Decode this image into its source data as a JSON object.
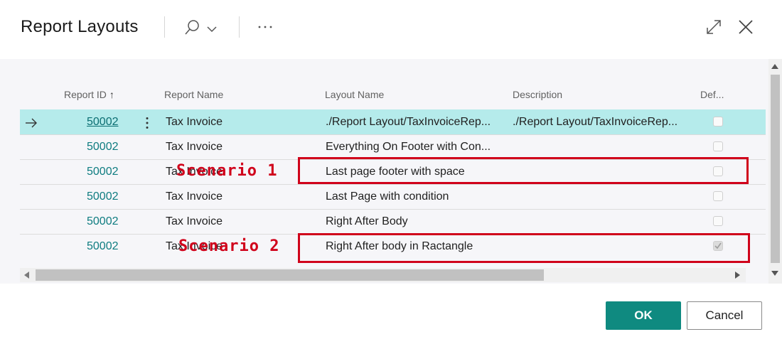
{
  "dialog": {
    "title": "Report Layouts",
    "search_icon": "search-icon",
    "more_icon": "ellipsis-icon",
    "expand_icon": "expand-icon",
    "close_icon": "close-icon"
  },
  "table": {
    "columns": {
      "report_id": "Report ID",
      "sort_indicator": "↑",
      "report_name": "Report Name",
      "layout_name": "Layout Name",
      "description": "Description",
      "default": "Def..."
    },
    "rows": [
      {
        "report_id": "50002",
        "report_name": "Tax Invoice",
        "layout_name": "./Report Layout/TaxInvoiceRep...",
        "description": "./Report Layout/TaxInvoiceRep...",
        "default": false,
        "selected": true
      },
      {
        "report_id": "50002",
        "report_name": "Tax Invoice",
        "layout_name": "Everything On Footer with Con...",
        "description": "",
        "default": false,
        "selected": false
      },
      {
        "report_id": "50002",
        "report_name": "Tax Invoice",
        "layout_name": "Last page footer with space",
        "description": "",
        "default": false,
        "selected": false
      },
      {
        "report_id": "50002",
        "report_name": "Tax Invoice",
        "layout_name": "Last Page with condition",
        "description": "",
        "default": false,
        "selected": false
      },
      {
        "report_id": "50002",
        "report_name": "Tax Invoice",
        "layout_name": "Right After Body",
        "description": "",
        "default": false,
        "selected": false
      },
      {
        "report_id": "50002",
        "report_name": "Tax Invoice",
        "layout_name": "Right After body in Ractangle",
        "description": "",
        "default": true,
        "selected": false
      }
    ]
  },
  "annotations": {
    "scenario1": "Scenario 1",
    "scenario2": "Scenario 2"
  },
  "footer": {
    "ok_label": "OK",
    "cancel_label": "Cancel"
  },
  "colors": {
    "accent": "#0f8a80",
    "selected_row": "#b5ebeb",
    "link": "#0e7c80",
    "annotation": "#d0021b"
  }
}
